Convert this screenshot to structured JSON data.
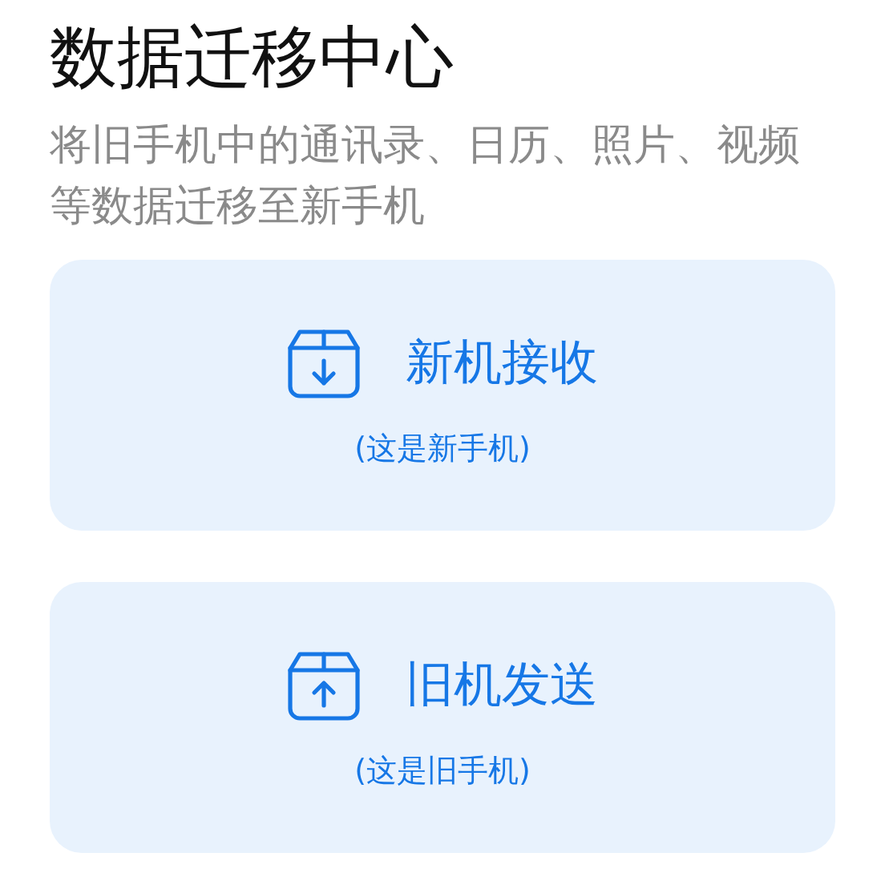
{
  "title": "数据迁移中心",
  "description": "将旧手机中的通讯录、日历、照片、视频等数据迁移至新手机",
  "options": [
    {
      "kind": "receive",
      "label": "新机接收",
      "note": "(这是新手机)"
    },
    {
      "kind": "send",
      "label": "旧机发送",
      "note": "(这是旧手机)"
    }
  ]
}
